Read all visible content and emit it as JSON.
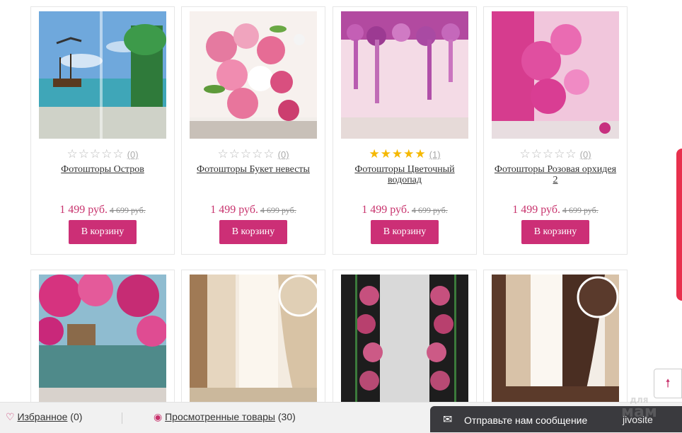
{
  "products": [
    {
      "title": "Фотошторы Остров",
      "price": "1 499 руб.",
      "old_price": "4 699 руб.",
      "rating_count": "(0)",
      "rating": 0,
      "button": "В корзину"
    },
    {
      "title": "Фотошторы Букет невесты",
      "price": "1 499 руб.",
      "old_price": "4 699 руб.",
      "rating_count": "(0)",
      "rating": 0,
      "button": "В корзину"
    },
    {
      "title": "Фотошторы Цветочный водопад",
      "price": "1 499 руб.",
      "old_price": "4 699 руб.",
      "rating_count": "(1)",
      "rating": 5,
      "button": "В корзину"
    },
    {
      "title": "Фотошторы Розовая орхидея 2",
      "price": "1 499 руб.",
      "old_price": "4 699 руб.",
      "rating_count": "(0)",
      "rating": 0,
      "button": "В корзину"
    }
  ],
  "bottom_bar": {
    "favorites_label": "Избранное",
    "favorites_count": "(0)",
    "viewed_label": "Просмотренные товары",
    "viewed_count": "(30)"
  },
  "chat": {
    "message": "Отправьте нам сообщение",
    "brand": "jivosite"
  },
  "watermark": {
    "top": "для",
    "main": "мам"
  },
  "icons": {
    "heart": "heart-icon",
    "eye": "eye-icon",
    "envelope": "envelope-icon",
    "arrow_up": "arrow-up-icon",
    "star": "star-icon"
  },
  "colors": {
    "accent": "#cc2f76",
    "price": "#c8336d",
    "star": "#f5b800",
    "chat_bg": "#3a3a3e"
  }
}
